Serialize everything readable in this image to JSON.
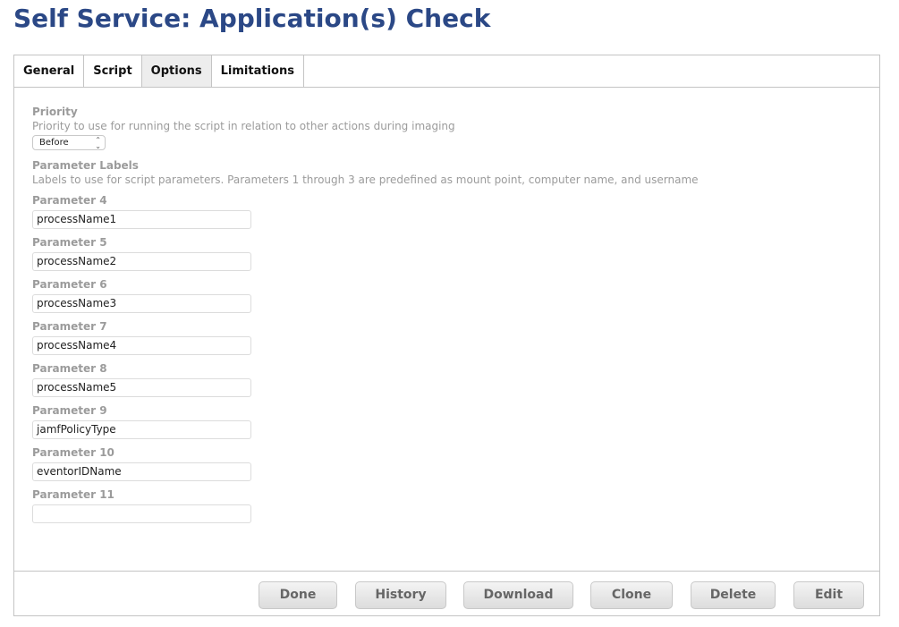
{
  "page": {
    "title": "Self Service: Application(s) Check"
  },
  "tabs": [
    {
      "label": "General",
      "active": false
    },
    {
      "label": "Script",
      "active": false
    },
    {
      "label": "Options",
      "active": true
    },
    {
      "label": "Limitations",
      "active": false
    }
  ],
  "priority": {
    "label": "Priority",
    "description": "Priority to use for running the script in relation to other actions during imaging",
    "selected": "Before"
  },
  "parameter_labels": {
    "label": "Parameter Labels",
    "description": "Labels to use for script parameters. Parameters 1 through 3 are predefined as mount point, computer name, and username"
  },
  "parameters": [
    {
      "label": "Parameter 4",
      "value": "processName1"
    },
    {
      "label": "Parameter 5",
      "value": "processName2"
    },
    {
      "label": "Parameter 6",
      "value": "processName3"
    },
    {
      "label": "Parameter 7",
      "value": "processName4"
    },
    {
      "label": "Parameter 8",
      "value": "processName5"
    },
    {
      "label": "Parameter 9",
      "value": "jamfPolicyType"
    },
    {
      "label": "Parameter 10",
      "value": "eventorIDName"
    },
    {
      "label": "Parameter 11",
      "value": ""
    }
  ],
  "footer": {
    "done": "Done",
    "history": "History",
    "download": "Download",
    "clone": "Clone",
    "delete": "Delete",
    "edit": "Edit"
  },
  "colors": {
    "title": "#2b4886",
    "label": "#9b9b9b",
    "border": "#c4c4c4"
  }
}
